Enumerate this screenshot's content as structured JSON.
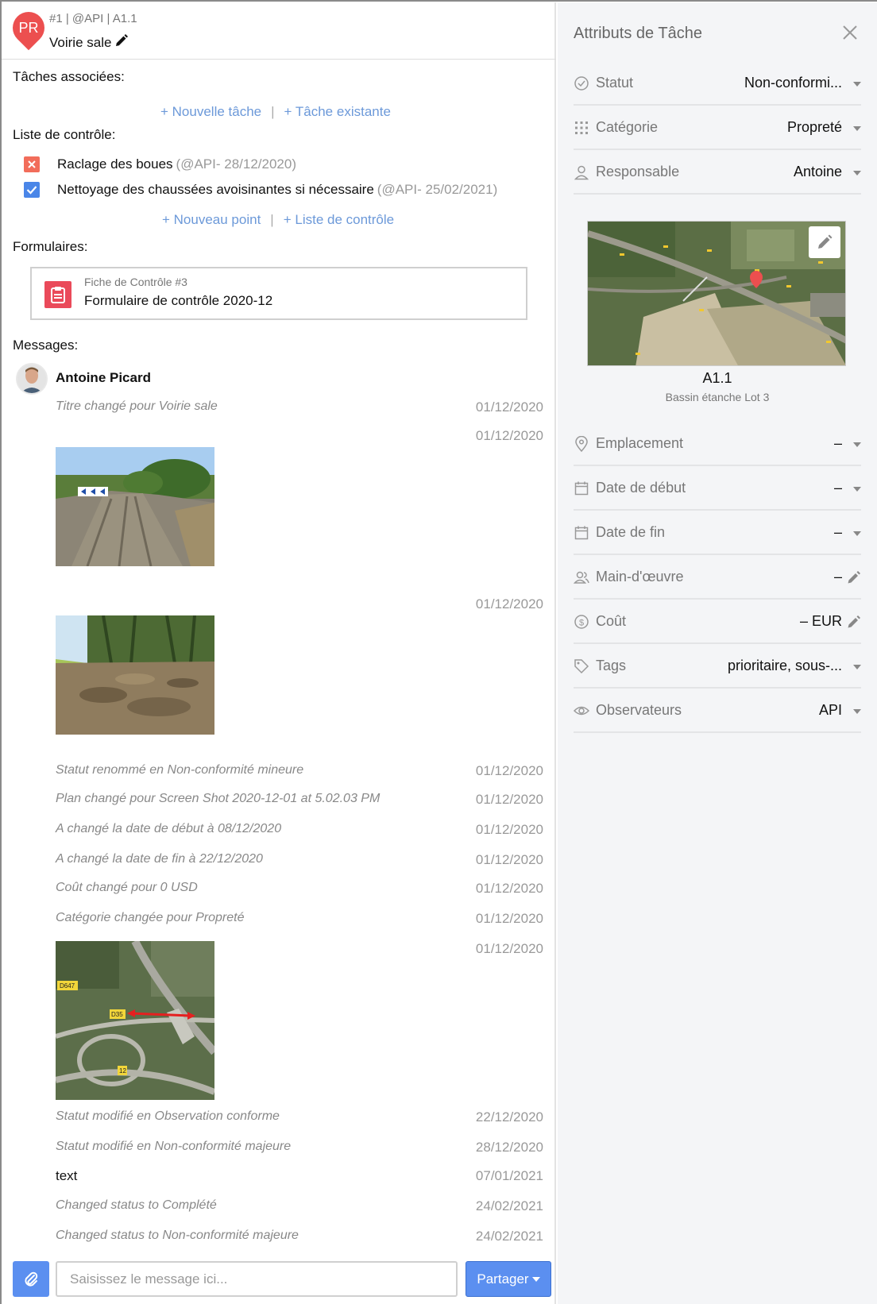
{
  "header": {
    "avatar_initials": "PR",
    "meta": "#1 | @API | A1.1",
    "title": "Voirie sale"
  },
  "tasks": {
    "label": "Tâches associées:",
    "new_task": "+ Nouvelle tâche",
    "existing_task": "+ Tâche existante",
    "separator": "|"
  },
  "checklist": {
    "label": "Liste de contrôle:",
    "items": [
      {
        "text": "Raclage des boues",
        "meta": "(@API- 28/12/2020)",
        "state": "failed",
        "color": "#f26d5b"
      },
      {
        "text": "Nettoyage des chaussées avoisinantes si nécessaire",
        "meta": "(@API- 25/02/2021)",
        "state": "checked",
        "color": "#4a86e8"
      }
    ],
    "new_point": "+ Nouveau point",
    "checklist_link": "+ Liste de contrôle"
  },
  "forms": {
    "label": "Formulaires:",
    "card_subtitle": "Fiche de Contrôle #3",
    "card_title": "Formulaire de contrôle 2020-12"
  },
  "messages": {
    "label": "Messages:",
    "author": "Antoine Picard",
    "items": [
      {
        "text": "Titre changé pour Voirie sale",
        "date": "01/12/2020"
      },
      {
        "text": "",
        "date": "01/12/2020",
        "image": "muddy-road-photo"
      },
      {
        "text": "",
        "date": "01/12/2020",
        "image": "muddy-field-photo"
      },
      {
        "text": "Statut renommé en Non-conformité mineure",
        "date": "01/12/2020"
      },
      {
        "text": "Plan changé pour Screen Shot 2020-12-01 at 5.02.03 PM",
        "date": "01/12/2020"
      },
      {
        "text": "A changé la date de début à 08/12/2020",
        "date": "01/12/2020"
      },
      {
        "text": "A changé la date de fin à 22/12/2020",
        "date": "01/12/2020"
      },
      {
        "text": "Coût changé pour 0 USD",
        "date": "01/12/2020"
      },
      {
        "text": "Catégorie changée pour Propreté",
        "date": "01/12/2020"
      },
      {
        "text": "",
        "date": "01/12/2020",
        "image": "aerial-map-photo"
      },
      {
        "text": "Statut modifié en Observation conforme",
        "date": "22/12/2020"
      },
      {
        "text": "Statut modifié en Non-conformité majeure",
        "date": "28/12/2020"
      },
      {
        "text": "text",
        "date": "07/01/2021"
      },
      {
        "text": "Changed status to Complété",
        "date": "24/02/2021"
      },
      {
        "text": "Changed status to Non-conformité majeure",
        "date": "24/02/2021"
      }
    ],
    "aerial_labels": [
      "D647",
      "D35",
      "12"
    ]
  },
  "composer": {
    "placeholder": "Saisissez le message ici...",
    "share_label": "Partager"
  },
  "attributes": {
    "title": "Attributs de Tâche",
    "status": {
      "label": "Statut",
      "value": "Non-conformi..."
    },
    "category": {
      "label": "Catégorie",
      "value": "Propreté"
    },
    "assignee": {
      "label": "Responsable",
      "value": "Antoine"
    },
    "plan": {
      "code": "A1.1",
      "name": "Bassin étanche Lot 3"
    },
    "location": {
      "label": "Emplacement",
      "value": "–"
    },
    "start_date": {
      "label": "Date de début",
      "value": "–"
    },
    "end_date": {
      "label": "Date de fin",
      "value": "–"
    },
    "labor": {
      "label": "Main-d'œuvre",
      "value": "–"
    },
    "cost": {
      "label": "Coût",
      "value": "– EUR"
    },
    "tags": {
      "label": "Tags",
      "value": "prioritaire, sous-..."
    },
    "observers": {
      "label": "Observateurs",
      "value": "API"
    }
  },
  "colors": {
    "accent": "#5b8ff0",
    "link": "#6c99d9",
    "pin": "#ec4f4f"
  }
}
